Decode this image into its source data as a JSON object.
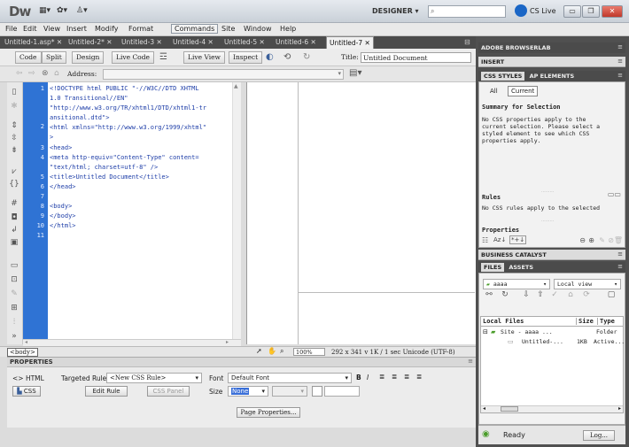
{
  "app": {
    "logo": "Dw",
    "workspace": "DESIGNER",
    "cs_live": "CS Live",
    "toolbar_icons": [
      "layout-icon",
      "gear-icon",
      "user-icon"
    ]
  },
  "menu": [
    "File",
    "Edit",
    "View",
    "Insert",
    "Modify",
    "Format",
    "Commands",
    "Site",
    "Window",
    "Help"
  ],
  "tabs": [
    {
      "label": "Untitled-1.asp*"
    },
    {
      "label": "Untitled-2*"
    },
    {
      "label": "Untitled-3"
    },
    {
      "label": "Untitled-4"
    },
    {
      "label": "Untitled-5"
    },
    {
      "label": "Untitled-6"
    },
    {
      "label": "Untitled-7"
    }
  ],
  "doc_toolbar": {
    "code": "Code",
    "split": "Split",
    "design": "Design",
    "live_code": "Live Code",
    "live_view": "Live View",
    "inspect": "Inspect",
    "title_label": "Title:",
    "title_value": "Untitled Document"
  },
  "address_label": "Address:",
  "code": {
    "lines": [
      {
        "n": "1",
        "text": "<!DOCTYPE html PUBLIC \"-//W3C//DTD XHTML"
      },
      {
        "n": "",
        "text": "1.0 Transitional//EN\""
      },
      {
        "n": "",
        "text": "\"http://www.w3.org/TR/xhtml1/DTD/xhtml1-tr"
      },
      {
        "n": "",
        "text": "ansitional.dtd\">"
      },
      {
        "n": "2",
        "text": "<html xmlns=\"http://www.w3.org/1999/xhtml\""
      },
      {
        "n": "",
        "text": ">"
      },
      {
        "n": "3",
        "text": "<head>"
      },
      {
        "n": "4",
        "text": "<meta http-equiv=\"Content-Type\" content="
      },
      {
        "n": "",
        "text": "\"text/html; charset=utf-8\" />"
      },
      {
        "n": "5",
        "text": "<title>Untitled Document</title>"
      },
      {
        "n": "6",
        "text": "</head>"
      },
      {
        "n": "7",
        "text": ""
      },
      {
        "n": "8",
        "text": "<body>"
      },
      {
        "n": "9",
        "text": "</body>"
      },
      {
        "n": "10",
        "text": "</html>"
      },
      {
        "n": "11",
        "text": ""
      }
    ]
  },
  "status": {
    "tag": "<body>",
    "zoom": "100%",
    "info": "292 x 341 v 1K / 1 sec Unicode (UTF-8)"
  },
  "properties": {
    "title": "PROPERTIES",
    "html_btn": "HTML",
    "css_btn": "CSS",
    "targeted_rule_label": "Targeted Rule",
    "targeted_rule_value": "<New CSS Rule>",
    "edit_rule": "Edit Rule",
    "css_panel": "CSS Panel",
    "font_label": "Font",
    "font_value": "Default Font",
    "size_label": "Size",
    "size_value": "None",
    "page_properties": "Page Properties...",
    "format_icons": [
      "B",
      "I"
    ]
  },
  "panels": {
    "browserlab": "ADOBE BROWSERLAB",
    "insert": "INSERT",
    "css_styles": "CSS STYLES",
    "ap_elements": "AP ELEMENTS",
    "all": "All",
    "current": "Current",
    "summary_title": "Summary for Selection",
    "summary_text_1": "No CSS properties apply to the",
    "summary_text_2": "current selection.  Please select a",
    "summary_text_3": "styled element to see which CSS",
    "summary_text_4": "properties apply.",
    "rules_title": "Rules",
    "rules_text": "No CSS rules apply to the selected",
    "properties_title": "Properties",
    "business_catalyst": "BUSINESS CATALYST",
    "files": "FILES",
    "assets": "ASSETS",
    "site_select": "aaaa",
    "view_select": "Local view",
    "col_local": "Local Files",
    "col_size": "Size",
    "col_type": "Type",
    "row1_name": "Site - aaaa ...",
    "row1_type": "Folder",
    "row2_name": "Untitled-...",
    "row2_size": "1KB",
    "row2_type": "Active...",
    "ready": "Ready",
    "log": "Log..."
  }
}
